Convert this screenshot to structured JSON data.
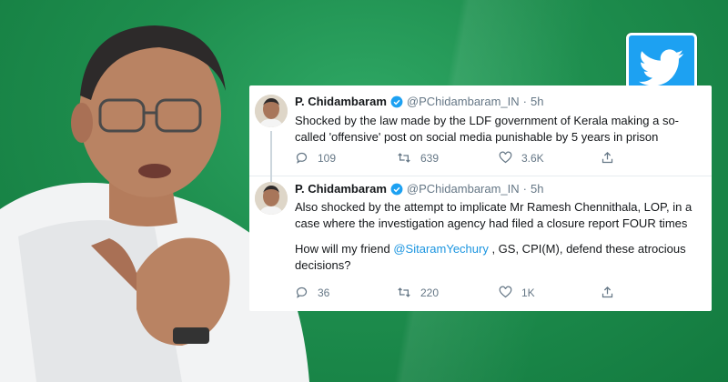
{
  "tweets": [
    {
      "name": "P. Chidambaram",
      "handle": "@PChidambaram_IN",
      "separator": "·",
      "time": "5h",
      "paragraphs": [
        "Shocked by the law made by the LDF government of Kerala making a so-called 'offensive' post on social media punishable by 5 years in prison"
      ],
      "replies": "109",
      "retweets": "639",
      "likes": "3.6K"
    },
    {
      "name": "P. Chidambaram",
      "handle": "@PChidambaram_IN",
      "separator": "·",
      "time": "5h",
      "paragraph1": "Also shocked by the attempt to implicate Mr Ramesh Chennithala, LOP, in a case where the investigation agency had filed a closure report FOUR times",
      "paragraph2_before": "How will my friend ",
      "paragraph2_mention": "@SitaramYechury",
      "paragraph2_after": " , GS, CPI(M), defend these atrocious decisions?",
      "replies": "36",
      "retweets": "220",
      "likes": "1K"
    }
  ],
  "colors": {
    "background_green": "#1e8e4e",
    "twitter_blue": "#1da1f2",
    "mention_blue": "#1b95e0",
    "secondary_text": "#657786"
  },
  "icons": [
    "twitter-bird-icon",
    "verified-icon",
    "reply-icon",
    "retweet-icon",
    "like-icon",
    "share-icon"
  ]
}
